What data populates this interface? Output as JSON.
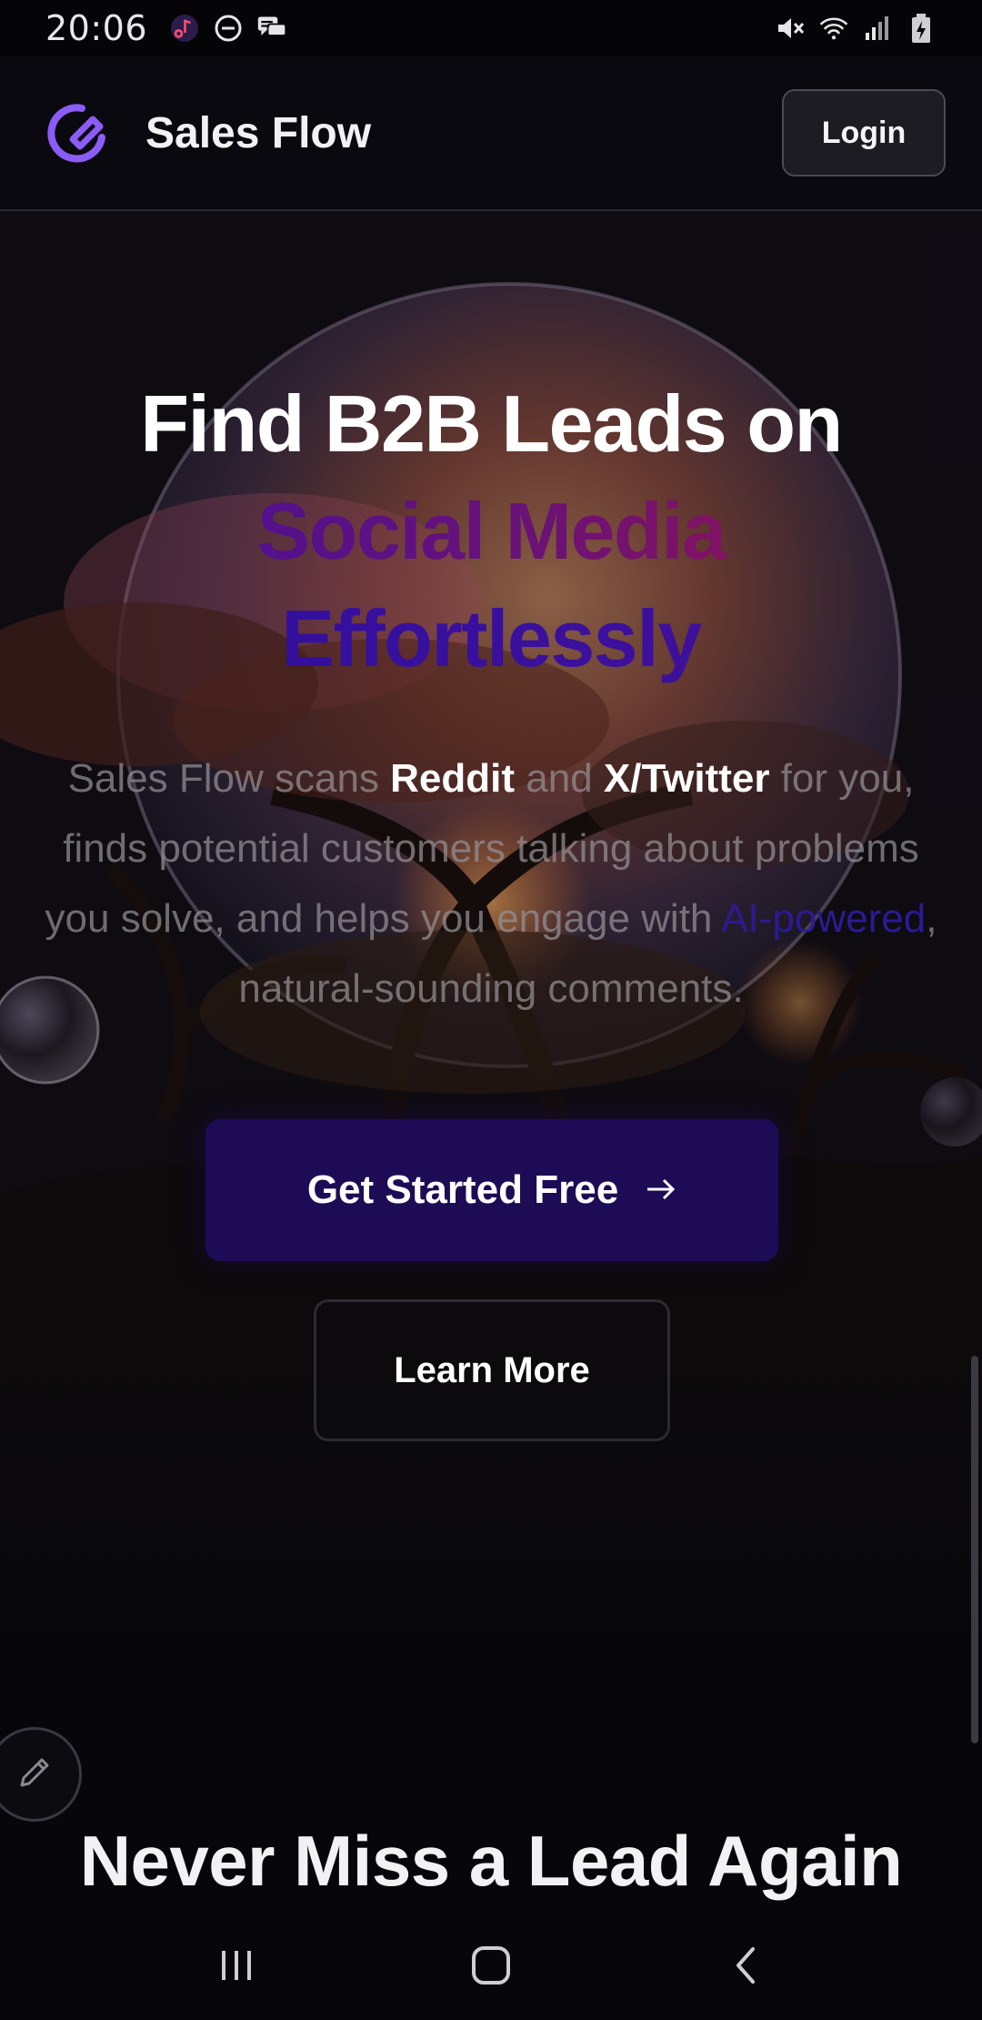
{
  "status_bar": {
    "time": "20:06",
    "left_icons": [
      "music-notification-icon",
      "do-not-disturb-icon",
      "chat-notification-icon"
    ],
    "right_icons": [
      "mute-icon",
      "wifi-icon",
      "signal-icon",
      "battery-charging-icon"
    ]
  },
  "header": {
    "brand": "Sales Flow",
    "login_label": "Login",
    "logo_icon": "sales-flow-logo-icon"
  },
  "hero": {
    "title_line1": "Find B2B Leads on",
    "title_line2": "Social Media",
    "title_line3": "Effortlessly",
    "desc": {
      "p1": "Sales Flow scans ",
      "reddit": "Reddit",
      "p2": " and ",
      "twitter": "X/Twitter",
      "p3": " for you, finds potential customers talking about problems you solve, and helps you engage with ",
      "ai": "AI-powered",
      "p4": ", natural-sounding comments."
    },
    "cta_primary_label": "Get Started Free",
    "cta_primary_icon": "arrow-right-icon",
    "cta_secondary_label": "Learn More"
  },
  "section": {
    "title": "Never Miss a Lead Again"
  },
  "fab": {
    "icon": "pencil-icon"
  },
  "nav_bar": {
    "buttons": [
      "recent-apps-icon",
      "home-icon",
      "back-icon"
    ]
  },
  "colors": {
    "accent": "#1d0c55",
    "gradient_start": "#3f0ea3",
    "gradient_end": "#a3124a",
    "logo": "#8b5cf6"
  }
}
